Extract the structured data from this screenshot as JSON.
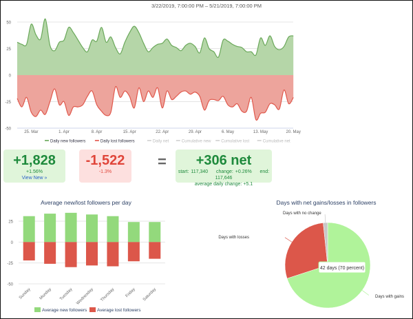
{
  "chart_data": [
    {
      "type": "area",
      "title": "3/22/2019, 7:00:00 PM – 5/21/2019, 7:00:00 PM",
      "x_start": "2019-03-22",
      "x_ticks": [
        "25. Mar",
        "1. Apr",
        "8. Apr",
        "15. Apr",
        "22. Apr",
        "29. Apr",
        "6. May",
        "13. May",
        "20. May"
      ],
      "y_ticks": [
        50,
        25,
        0,
        -25,
        -50
      ],
      "ylim": [
        -50,
        50
      ],
      "grid": true,
      "legend_position": "bottom",
      "legend": [
        {
          "name": "Daily new followers",
          "color": "#5aa14a",
          "active": true
        },
        {
          "name": "Daily lost followers",
          "color": "#e0453a",
          "active": true
        },
        {
          "name": "Daily net",
          "color": "#cccccc",
          "active": false
        },
        {
          "name": "Cumulative new",
          "color": "#cccccc",
          "active": false
        },
        {
          "name": "Cumulative lost",
          "color": "#cccccc",
          "active": false
        },
        {
          "name": "Cumulative net",
          "color": "#cccccc",
          "active": false
        }
      ],
      "series": [
        {
          "name": "Daily new followers",
          "color": "#6aa85a",
          "fill": "#b5d6a8",
          "values": [
            31,
            29,
            29,
            48,
            38,
            34,
            53,
            28,
            23,
            31,
            33,
            45,
            40,
            33,
            26,
            22,
            33,
            32,
            45,
            31,
            36,
            26,
            20,
            31,
            40,
            46,
            40,
            30,
            22,
            26,
            29,
            30,
            34,
            28,
            26,
            23,
            28,
            30,
            27,
            21,
            35,
            25,
            22,
            17,
            33,
            32,
            29,
            27,
            26,
            22,
            22,
            19,
            35,
            28,
            37,
            27,
            24,
            27,
            36,
            37
          ]
        },
        {
          "name": "Daily lost followers",
          "color": "#e0574b",
          "fill": "#eda49c",
          "values": [
            -22,
            -30,
            -21,
            -35,
            -39,
            -33,
            -37,
            -25,
            -13,
            -28,
            -25,
            -38,
            -30,
            -30,
            -28,
            -20,
            -15,
            -28,
            -34,
            -38,
            -35,
            -11,
            -21,
            -15,
            -20,
            -31,
            -12,
            -25,
            -15,
            -21,
            -12,
            -31,
            -15,
            -23,
            -20,
            -16,
            -15,
            -18,
            -16,
            -20,
            -33,
            -24,
            -23,
            -24,
            -20,
            -28,
            -30,
            -27,
            -34,
            -34,
            -21,
            -42,
            -36,
            -35,
            -27,
            -28,
            -32,
            -14,
            -27,
            -21
          ]
        }
      ]
    },
    {
      "type": "bar",
      "title": "Average new/lost followers per day",
      "categories": [
        "Sunday",
        "Monday",
        "Tuesday",
        "Wednesday",
        "Thursday",
        "Friday",
        "Saturday"
      ],
      "y_ticks": [
        25,
        0,
        -25,
        -50
      ],
      "ylim": [
        -50,
        37
      ],
      "legend_position": "bottom",
      "series": [
        {
          "name": "Average new followers",
          "color": "#93d97c",
          "values": [
            31,
            34,
            35,
            33,
            31,
            24,
            24
          ]
        },
        {
          "name": "Average lost followers",
          "color": "#dc574a",
          "values": [
            -22,
            -26,
            -30,
            -28,
            -29,
            -23,
            -20
          ]
        }
      ]
    },
    {
      "type": "pie",
      "title": "Days with net gains/losses in followers",
      "slices": [
        {
          "label": "Days with gains",
          "value": 42,
          "color": "#b0f39a"
        },
        {
          "label": "Days with losses",
          "value": 17,
          "color": "#dc574a"
        },
        {
          "label": "Days with no change",
          "value": 1,
          "color": "#c8c8c8"
        }
      ],
      "tooltip": "42 days (70 percent)"
    }
  ],
  "summary": {
    "new": {
      "value": "+1,828",
      "pct": "+1.56%",
      "link": "View New »"
    },
    "lost": {
      "value": "-1,522",
      "pct": "-1.3%"
    },
    "equals": "=",
    "net": {
      "value": "+306 net",
      "start": "start: 117,340",
      "change": "change: +0.26%",
      "end": "end: 117,646",
      "avg": "average daily change: +5.1"
    }
  },
  "colors": {
    "green_text": "#1e8a3c",
    "red_text": "#e0453a",
    "green_box": "#e0f5da",
    "red_box": "#fde0df",
    "link": "#2a5fc8"
  }
}
